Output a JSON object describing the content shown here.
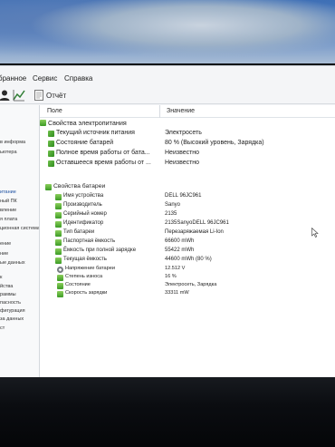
{
  "menubar": {
    "items": [
      "бранное",
      "Сервис",
      "Справка"
    ]
  },
  "toolbar": {
    "report_label": "Отчёт"
  },
  "sidebar": {
    "items": [
      "в информа",
      "ьютера",
      "итание",
      "ный ПК",
      "вление",
      "я плата",
      "ционная система",
      "ение",
      "ние",
      "ые данных",
      "к",
      "йства",
      "раммы",
      "пасность",
      "фигурация",
      "за данных",
      "ст"
    ]
  },
  "table": {
    "col_field": "Поле",
    "col_value": "Значение",
    "power_section": {
      "title": "Свойства электропитания",
      "rows": [
        {
          "field": "Текущий источник питания",
          "value": "Электросеть"
        },
        {
          "field": "Состояние батарей",
          "value": "80 % (Высокий уровень, Зарядка)"
        },
        {
          "field": "Полное время работы от бата...",
          "value": "Неизвестно"
        },
        {
          "field": "Оставшееся время работы от ...",
          "value": "Неизвестно"
        }
      ]
    },
    "battery_section": {
      "title": "Свойства батареи",
      "rows": [
        {
          "field": "Имя устройства",
          "value": "DELL 96JC961"
        },
        {
          "field": "Производитель",
          "value": "Sanyo"
        },
        {
          "field": "Серийный номер",
          "value": "2135"
        },
        {
          "field": "Идентификатор",
          "value": "2135SanyoDELL 96JC961"
        },
        {
          "field": "Тип батареи",
          "value": "Перезаряжаемая Li-Ion"
        },
        {
          "field": "Паспортная ёмкость",
          "value": "66600 mWh"
        },
        {
          "field": "Ёмкость при полной зарядке",
          "value": "55422 mWh"
        },
        {
          "field": "Текущая ёмкость",
          "value": "44600 mWh  (80 %)"
        },
        {
          "field": "Напряжение батареи",
          "value": "12.512 V"
        },
        {
          "field": "Степень износа",
          "value": "16 %"
        },
        {
          "field": "Состояние",
          "value": "Электросеть, Зарядка"
        },
        {
          "field": "Скорость зарядки",
          "value": "33311 mW"
        }
      ]
    }
  },
  "colors": {
    "window_bg": "#f4f5f7",
    "content_bg": "#ffffff",
    "icon_green": "#3b9a25",
    "selected_text": "#1b4fa0"
  }
}
